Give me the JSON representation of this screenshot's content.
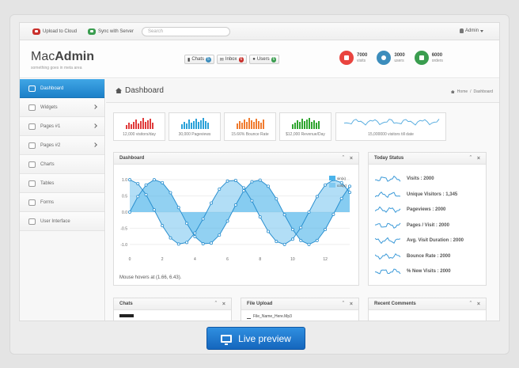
{
  "topbar": {
    "upload_label": "Upload to Cloud",
    "sync_label": "Sync with Server",
    "search_placeholder": "Search",
    "admin_label": "Admin"
  },
  "header": {
    "logo_light": "Mac",
    "logo_bold": "Admin",
    "tagline": "something goes in meta area",
    "buttons": [
      {
        "label": "Chats",
        "count": "5",
        "icon": "chat-icon"
      },
      {
        "label": "Inbox",
        "count": "6",
        "icon": "inbox-icon"
      },
      {
        "label": "Users",
        "count": "6",
        "icon": "users-icon"
      }
    ],
    "stats": [
      {
        "value": "7000",
        "label": "visits",
        "color": "#e9443f"
      },
      {
        "value": "3000",
        "label": "users",
        "color": "#3c8dbc"
      },
      {
        "value": "6000",
        "label": "orders",
        "color": "#3a9d4f"
      }
    ]
  },
  "sidebar": {
    "items": [
      {
        "label": "Dashboard",
        "icon": "monitor-icon"
      },
      {
        "label": "Widgets",
        "icon": "window-icon"
      },
      {
        "label": "Pages #1",
        "icon": "file-icon"
      },
      {
        "label": "Pages #2",
        "icon": "file-icon"
      },
      {
        "label": "Charts",
        "icon": "chart-icon"
      },
      {
        "label": "Tables",
        "icon": "table-icon"
      },
      {
        "label": "Forms",
        "icon": "form-icon"
      },
      {
        "label": "User Interface",
        "icon": "wrench-icon"
      }
    ]
  },
  "page": {
    "title": "Dashboard",
    "breadcrumb": [
      "Home",
      "Dashboard"
    ]
  },
  "sparks": [
    {
      "label": "12,000 visitors/day",
      "color": "#e03b3b"
    },
    {
      "label": "30,000 Pageviews",
      "color": "#2aa1d8"
    },
    {
      "label": "15.66% Bounce Rate",
      "color": "#f07b2f"
    },
    {
      "label": "$12,000 Revenue/Day",
      "color": "#2fa52f"
    },
    {
      "label": "15,000000 visitors till date",
      "color": "#5aaee0"
    }
  ],
  "dashboard_panel": {
    "title": "Dashboard",
    "footer": "Mouse hovers at (1.66, 6.43).",
    "legend": [
      "sin(x)",
      "cos(x)"
    ]
  },
  "chart_data": {
    "type": "area",
    "x": [
      0,
      0.5,
      1,
      1.5,
      2,
      2.5,
      3,
      3.5,
      4,
      4.5,
      5,
      5.5,
      6,
      6.5,
      7,
      7.5,
      8,
      8.5,
      9,
      9.5,
      10,
      10.5,
      11,
      11.5,
      12,
      12.5,
      13,
      13.5
    ],
    "series": [
      {
        "name": "sin(x)",
        "values": [
          0,
          0.48,
          0.84,
          1.0,
          0.91,
          0.6,
          0.14,
          -0.35,
          -0.76,
          -0.98,
          -0.96,
          -0.71,
          -0.28,
          0.22,
          0.66,
          0.94,
          0.99,
          0.8,
          0.41,
          -0.08,
          -0.54,
          -0.88,
          -1.0,
          -0.88,
          -0.54,
          -0.07,
          0.42,
          0.8
        ]
      },
      {
        "name": "cos(x)",
        "values": [
          1.0,
          0.88,
          0.54,
          0.07,
          -0.42,
          -0.8,
          -0.99,
          -0.94,
          -0.65,
          -0.21,
          0.28,
          0.71,
          0.96,
          0.98,
          0.75,
          0.35,
          -0.15,
          -0.6,
          -0.91,
          -1.0,
          -0.84,
          -0.48,
          0.0,
          0.48,
          0.84,
          1.0,
          0.91,
          0.61
        ]
      }
    ],
    "xticks": [
      "0",
      "2",
      "4",
      "6",
      "8",
      "10",
      "12"
    ],
    "yticks": [
      "1.0",
      "0.5",
      "0.0",
      "-0.5",
      "-1.0"
    ],
    "xlim": [
      0,
      13.5
    ],
    "ylim": [
      -1.2,
      1.2
    ],
    "legend": "top-right",
    "colors": [
      "#4ab3ea",
      "#7fc8f0"
    ]
  },
  "today_status": {
    "title": "Today Status",
    "rows": [
      "Visits : 2000",
      "Unique Visitors : 1,345",
      "Pageviews : 2000",
      "Pages / Visit : 2000",
      "Avg. Visit Duration : 2000",
      "Bounce Rate : 2000",
      "% New Visits : 2000"
    ]
  },
  "bottom_panels": {
    "chats": "Chats",
    "file_upload": "File Upload",
    "file_name": "File_Name_Here.Mp3",
    "recent_comments": "Recent Comments"
  },
  "live_preview": "Live preview"
}
